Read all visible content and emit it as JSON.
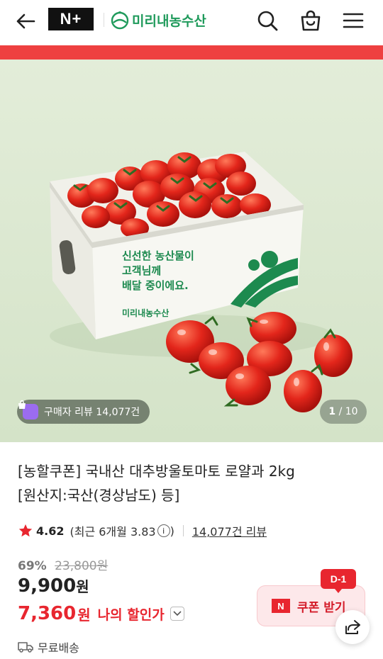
{
  "header": {
    "np_logo": "N+",
    "store_name": "미리내농수산"
  },
  "hero": {
    "box_text_lines": [
      "신선한 농산물이",
      "고객님께",
      "배달 중이에요."
    ],
    "box_brand": "미리내농수산",
    "review_pill": "구매자 리뷰 14,077건",
    "page_current": "1",
    "page_total": "10"
  },
  "product": {
    "title_line1": "[농할쿠폰] 국내산 대추방울토마토 로얄과 2kg",
    "title_line2": "[원산지:국산(경상남도) 등]",
    "rating": "4.62",
    "rating_recent_prefix": "(최근 6개월 3.83",
    "rating_recent_suffix": ")",
    "review_count_link": "14,077건 리뷰",
    "discount_pct": "69%",
    "original_price": "23,800원",
    "price": "9,900",
    "price_unit": "원",
    "my_price": "7,360",
    "my_price_unit": "원",
    "my_price_label": "나의 할인가",
    "shipping": "무료배송"
  },
  "coupon": {
    "badge": "D-1",
    "n_mark": "N",
    "label": "쿠폰 받기"
  },
  "colors": {
    "accent_red": "#e8262f",
    "brand_green": "#1f9a5b",
    "hero_bg": "#dfead5"
  }
}
